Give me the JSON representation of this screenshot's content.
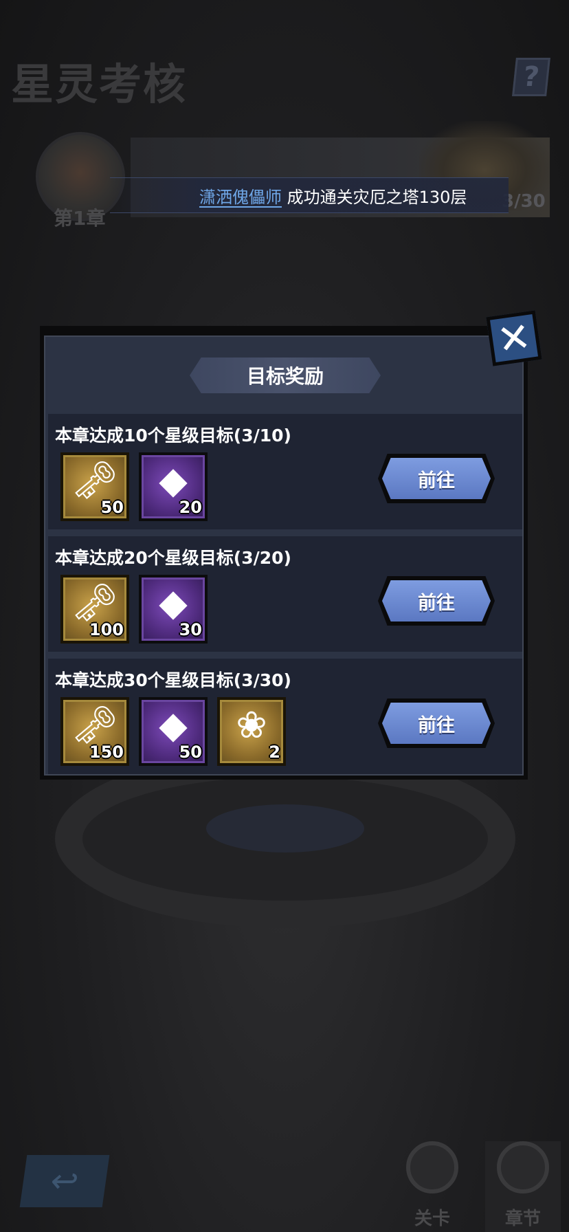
{
  "page": {
    "title": "星灵考核",
    "help_icon": "question-icon",
    "help_label": "?"
  },
  "chapter": {
    "label": "第1章",
    "progress": "3/30"
  },
  "ticker": {
    "player_name": "潇洒傀儡师",
    "message": "成功通关灾厄之塔130层"
  },
  "dialog": {
    "title": "目标奖励",
    "close_label": "✕",
    "goals": [
      {
        "title": "本章达成10个星级目标(3/10)",
        "rewards": [
          {
            "icon": "flame-key-icon",
            "count": "50"
          },
          {
            "icon": "purple-crystal-icon",
            "count": "20"
          }
        ],
        "button": "前往"
      },
      {
        "title": "本章达成20个星级目标(3/20)",
        "rewards": [
          {
            "icon": "flame-key-icon",
            "count": "100"
          },
          {
            "icon": "purple-crystal-icon",
            "count": "30"
          }
        ],
        "button": "前往"
      },
      {
        "title": "本章达成30个星级目标(3/30)",
        "rewards": [
          {
            "icon": "flame-key-icon",
            "count": "150"
          },
          {
            "icon": "purple-crystal-icon",
            "count": "50"
          },
          {
            "icon": "rose-scroll-icon",
            "count": "2"
          }
        ],
        "button": "前往"
      }
    ]
  },
  "bottom_nav": {
    "back_icon": "back-arrow-icon",
    "tabs": [
      {
        "label": "关卡",
        "icon": "stage-icon"
      },
      {
        "label": "章节",
        "icon": "chapter-icon"
      }
    ]
  },
  "colors": {
    "dialog_bg": "#2c3344",
    "row_bg": "#1f2433",
    "button_blue": "#6d8ad2",
    "close_blue": "#2c4f82",
    "link_blue": "#6fa7e8"
  }
}
